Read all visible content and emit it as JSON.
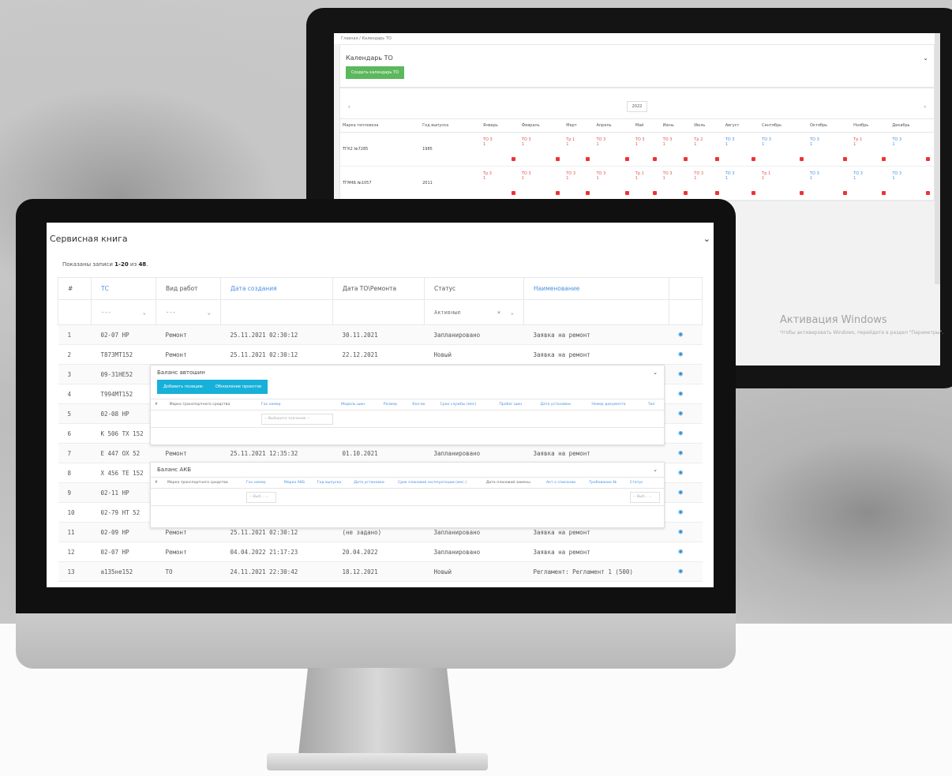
{
  "back_screen": {
    "breadcrumb": "Главная / Календарь ТО",
    "title": "Календарь ТО",
    "create_button": "Создать календарь ТО",
    "prev": "‹",
    "next": "›",
    "year": "2022",
    "columns": [
      "Марка тепловоза",
      "Год выпуска",
      "Январь",
      "Февраль",
      "Март",
      "Апрель",
      "Май",
      "Июнь",
      "Июль",
      "Август",
      "Сентябрь",
      "Октябрь",
      "Ноябрь",
      "Декабрь"
    ],
    "rows": [
      {
        "model": "ТГК2 №7285",
        "year": "1985",
        "events": [
          "ТО 3\n1",
          "ТО 3\n1",
          "Тр 1\n1",
          "ТО 3\n1",
          "ТО 3\n1",
          "ТО 3\n1",
          "Тр 2\n1",
          "ТО 3\n1",
          "ТО 3\n1",
          "ТО 3\n1",
          "Тр 1\n1",
          "ТО 3\n1"
        ]
      },
      {
        "model": "ТГМ4Б №1057",
        "year": "2011",
        "events": [
          "Тр 3\n1",
          "ТО 3\n1",
          "ТО 3\n1",
          "ТО 3\n1",
          "Тр 1\n1",
          "ТО 3\n1",
          "ТО 3\n1",
          "ТО 3\n1",
          "Тр 1\n1",
          "ТО 3\n1",
          "ТО 3\n1",
          "ТО 3\n1"
        ]
      }
    ],
    "watermark_title": "Активация Windows",
    "watermark_sub": "Чтобы активировать Windows, перейдите в раздел \"Параметры\"."
  },
  "front_screen": {
    "title": "Сервисная книга",
    "summary_prefix": "Показаны записи ",
    "summary_range": "1-20",
    "summary_mid": " из ",
    "summary_total": "48",
    "summary_end": ".",
    "headers": [
      "#",
      "ТС",
      "Вид работ",
      "Дата создания",
      "Дата ТО\\Ремонта",
      "Статус",
      "Наименование"
    ],
    "filter_placeholder": "---",
    "status_filter": "Активные",
    "rows": [
      {
        "n": "1",
        "ts": "02-07 НР",
        "work": "Ремонт",
        "created": "25.11.2021 02:30:12",
        "date": "30.11.2021",
        "status": "Запланировано",
        "name": "Заявка на ремонт"
      },
      {
        "n": "2",
        "ts": "Т873МТ152",
        "work": "Ремонт",
        "created": "25.11.2021 02:30:12",
        "date": "22.12.2021",
        "status": "Новый",
        "name": "Заявка на ремонт"
      },
      {
        "n": "3",
        "ts": "09-31НЕ52",
        "work": "",
        "created": "",
        "date": "",
        "status": "",
        "name": ""
      },
      {
        "n": "4",
        "ts": "Т994МТ152",
        "work": "",
        "created": "",
        "date": "",
        "status": "",
        "name": ""
      },
      {
        "n": "5",
        "ts": "02-08 НР",
        "work": "",
        "created": "",
        "date": "",
        "status": "",
        "name": ""
      },
      {
        "n": "6",
        "ts": "К 506 ТХ 152",
        "work": "",
        "created": "",
        "date": "",
        "status": "",
        "name": ""
      },
      {
        "n": "7",
        "ts": "Е 447 ОХ 52",
        "work": "Ремонт",
        "created": "25.11.2021 12:35:32",
        "date": "01.10.2021",
        "status": "Запланировано",
        "name": "Заявка на ремонт"
      },
      {
        "n": "8",
        "ts": "Х 456 ТЕ 152",
        "work": "",
        "created": "",
        "date": "",
        "status": "",
        "name": ""
      },
      {
        "n": "9",
        "ts": "02-11 НР",
        "work": "",
        "created": "",
        "date": "",
        "status": "",
        "name": ""
      },
      {
        "n": "10",
        "ts": "02-79 НТ 52",
        "work": "",
        "created": "",
        "date": "",
        "status": "",
        "name": ""
      },
      {
        "n": "11",
        "ts": "02-09 НР",
        "work": "Ремонт",
        "created": "25.11.2021 02:30:12",
        "date": "(не задано)",
        "status": "Запланировано",
        "name": "Заявка на ремонт"
      },
      {
        "n": "12",
        "ts": "02-07 НР",
        "work": "Ремонт",
        "created": "04.04.2022 21:17:23",
        "date": "20.04.2022",
        "status": "Запланировано",
        "name": "Заявка на ремонт"
      },
      {
        "n": "13",
        "ts": "а135не152",
        "work": "ТО",
        "created": "24.11.2021 22:30:42",
        "date": "18.12.2021",
        "status": "Новый",
        "name": "Регламент: Регламент 1 (500)"
      }
    ]
  },
  "tire_panel": {
    "title": "Баланс автошин",
    "btn_add": "Добавить позицию",
    "btn_update": "Обновление проектов",
    "columns": [
      "#",
      "Марка транспортного средства",
      "Гос.номер",
      "Модель шин",
      "Размер",
      "Кол-во",
      "Срок службы (мес)",
      "Пробег шин",
      "Дата установки",
      "Номер документа",
      "Тип"
    ],
    "select_placeholder": "-- Выберите значение --"
  },
  "battery_panel": {
    "title": "Баланс АКБ",
    "columns": [
      "#",
      "Марка транспортного средства",
      "Гос.номер",
      "Марка АКБ",
      "Год выпуска",
      "Дата установки",
      "Срок плановой эксплуатации (мес.)",
      "Дата плановой замены",
      "Акт о списании",
      "Требование №",
      "Статус"
    ],
    "select_placeholder": "-- Выб... --"
  }
}
